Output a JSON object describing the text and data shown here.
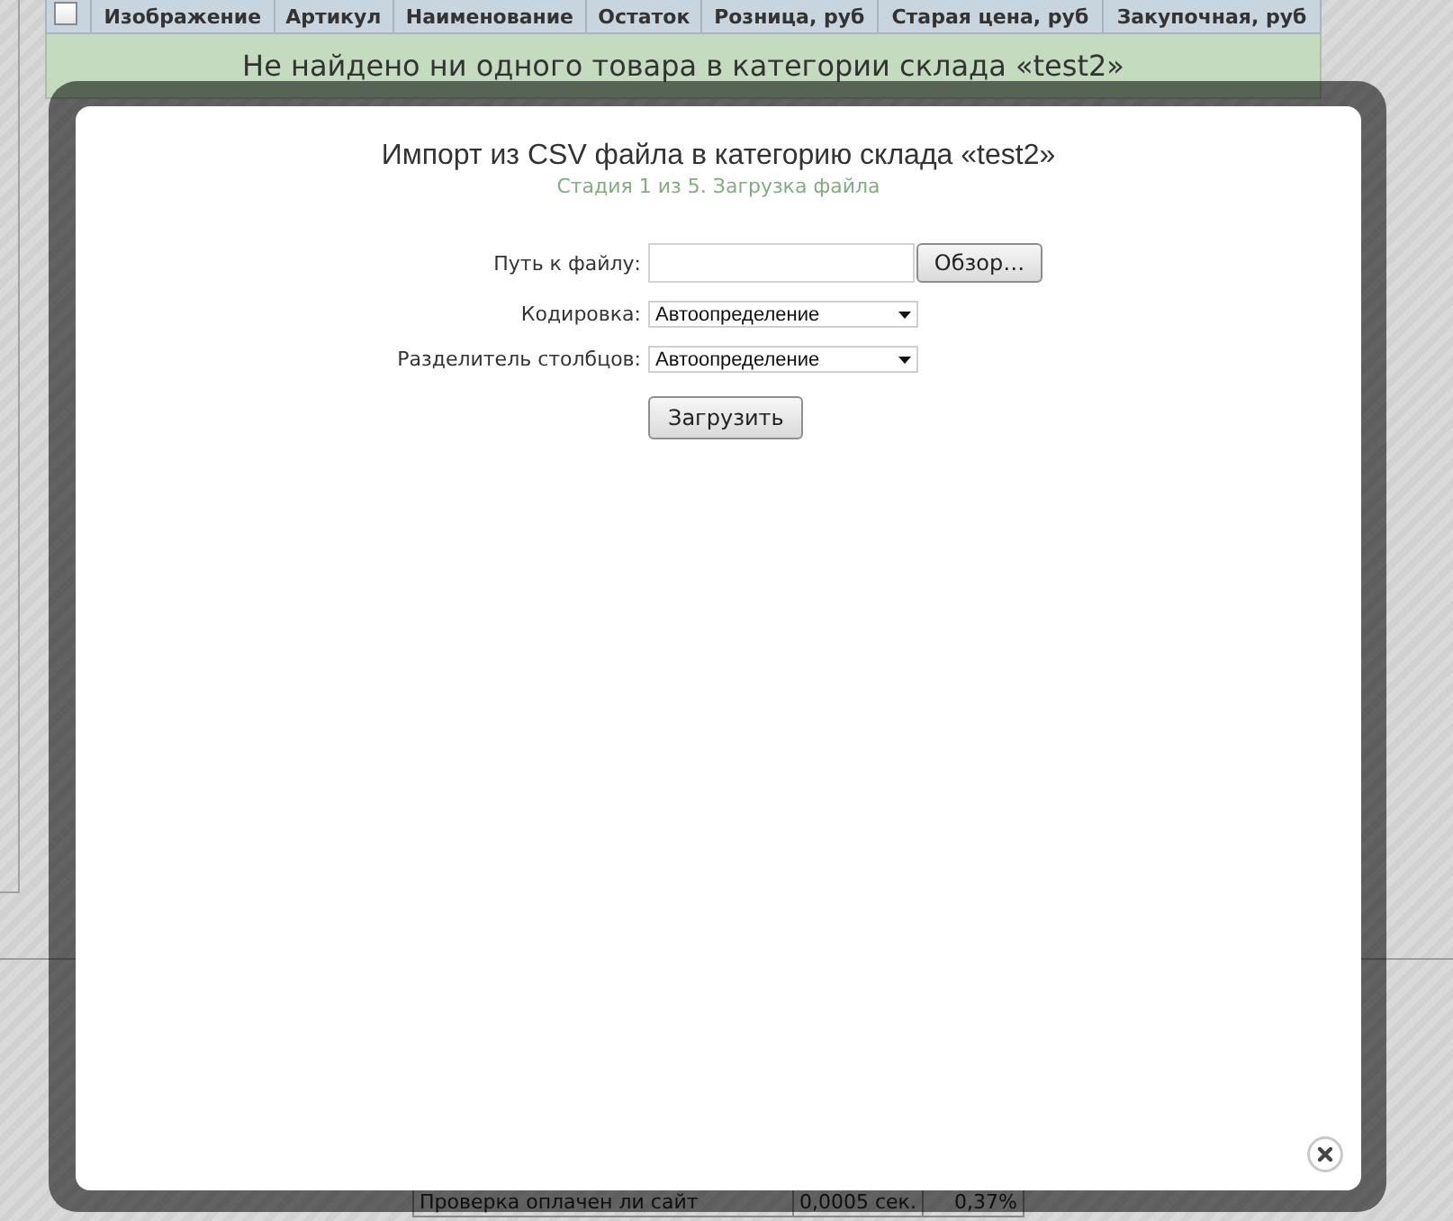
{
  "products_table": {
    "select_all": {
      "checked": false
    },
    "columns": [
      "Изображение",
      "Артикул",
      "Наименование",
      "Остаток",
      "Розница, руб",
      "Старая цена, руб",
      "Закупочная, руб"
    ],
    "empty_message": "Не найдено ни одного товара в категории склада «test2»"
  },
  "timing_table": {
    "rows": [
      {
        "cells": [
          "Проверка оплачен ли сайт",
          "0,0005 сек.",
          "0,37%"
        ]
      }
    ]
  },
  "dialog": {
    "title": "Импорт из CSV файла в категорию склада «test2»",
    "subtitle": "Стадия 1 из 5. Загрузка файла",
    "fields": [
      {
        "kind": "file",
        "label": "Путь к файлу:",
        "button": "Обзор…"
      },
      {
        "kind": "select",
        "label": "Кодировка:",
        "value": "Автоопределение"
      },
      {
        "kind": "select",
        "label": "Разделитель столбцов:",
        "value": "Автоопределение"
      }
    ],
    "submit": "Загрузить"
  }
}
